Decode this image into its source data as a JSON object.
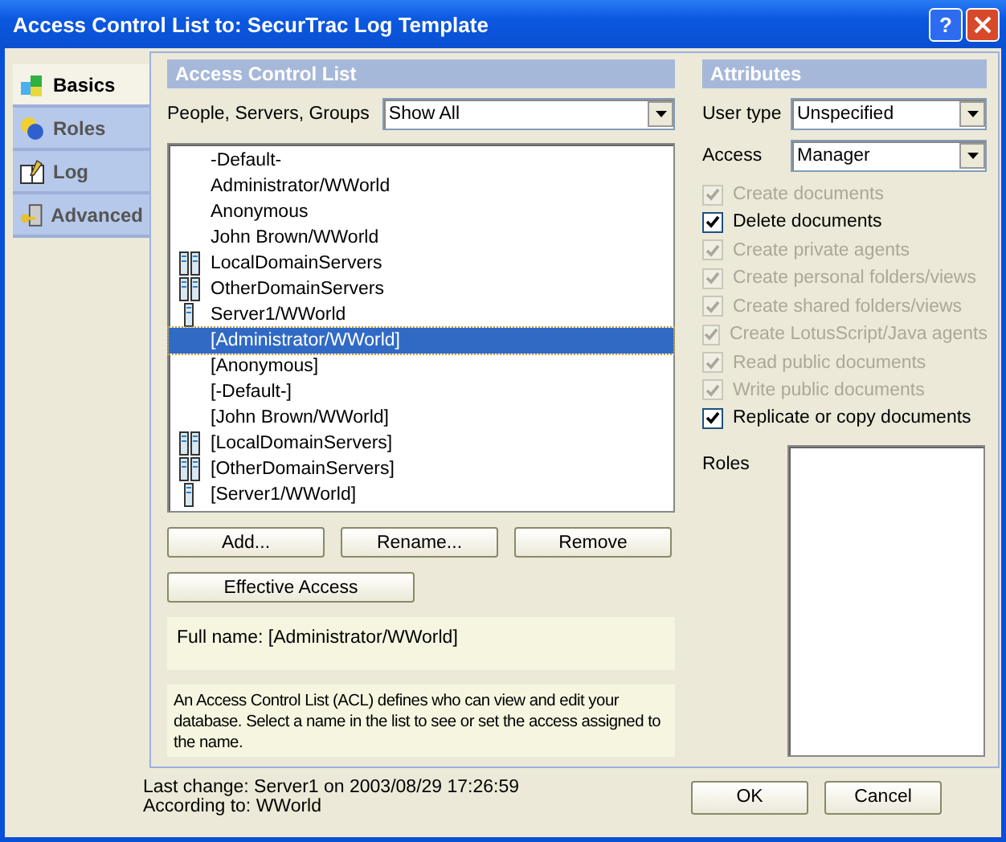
{
  "window": {
    "title": "Access Control List to: SecurTrac Log Template",
    "help": "?"
  },
  "tabs": [
    {
      "label": "Basics",
      "selected": true
    },
    {
      "label": "Roles",
      "selected": false
    },
    {
      "label": "Log",
      "selected": false
    },
    {
      "label": "Advanced",
      "selected": false
    }
  ],
  "acl": {
    "title": "Access Control List",
    "filter_label": "People, Servers, Groups",
    "filter_value": "Show All",
    "entries": [
      {
        "name": "-Default-",
        "kind": "person",
        "selected": false
      },
      {
        "name": "Administrator/WWorld",
        "kind": "person",
        "selected": false
      },
      {
        "name": "Anonymous",
        "kind": "person",
        "selected": false
      },
      {
        "name": "John Brown/WWorld",
        "kind": "person",
        "selected": false
      },
      {
        "name": "LocalDomainServers",
        "kind": "server-group",
        "selected": false
      },
      {
        "name": "OtherDomainServers",
        "kind": "server-group",
        "selected": false
      },
      {
        "name": "Server1/WWorld",
        "kind": "server",
        "selected": false
      },
      {
        "name": "[Administrator/WWorld]",
        "kind": "person",
        "selected": true
      },
      {
        "name": "[Anonymous]",
        "kind": "person",
        "selected": false
      },
      {
        "name": "[-Default-]",
        "kind": "person",
        "selected": false
      },
      {
        "name": "[John Brown/WWorld]",
        "kind": "person",
        "selected": false
      },
      {
        "name": "[LocalDomainServers]",
        "kind": "server-group",
        "selected": false
      },
      {
        "name": "[OtherDomainServers]",
        "kind": "server-group",
        "selected": false
      },
      {
        "name": "[Server1/WWorld]",
        "kind": "server",
        "selected": false
      }
    ],
    "buttons": [
      "Add...",
      "Rename...",
      "Remove"
    ],
    "effective_access": "Effective Access",
    "full_name": "Full name: [Administrator/WWorld]",
    "description": "An Access Control List (ACL) defines who can view and edit your database. Select a name in the list to see or set the access assigned to the name."
  },
  "attributes": {
    "title": "Attributes",
    "user_type_label": "User type",
    "user_type": "Unspecified",
    "access_label": "Access",
    "access": "Manager",
    "options": [
      {
        "label": "Create documents",
        "checked": true,
        "disabled": true
      },
      {
        "label": "Delete documents",
        "checked": true,
        "disabled": false
      },
      {
        "label": "Create private agents",
        "checked": true,
        "disabled": true
      },
      {
        "label": "Create personal folders/views",
        "checked": true,
        "disabled": true
      },
      {
        "label": "Create shared folders/views",
        "checked": true,
        "disabled": true
      },
      {
        "label": "Create LotusScript/Java agents",
        "checked": true,
        "disabled": true
      },
      {
        "label": "Read public documents",
        "checked": true,
        "disabled": true
      },
      {
        "label": "Write public documents",
        "checked": true,
        "disabled": true
      },
      {
        "label": "Replicate or copy documents",
        "checked": true,
        "disabled": false
      }
    ],
    "roles_label": "Roles"
  },
  "footer": {
    "last_change": "Last change: Server1 on 2003/08/29 17:26:59",
    "according_to": "According to: WWorld",
    "buttons": [
      "OK",
      "Cancel"
    ]
  }
}
